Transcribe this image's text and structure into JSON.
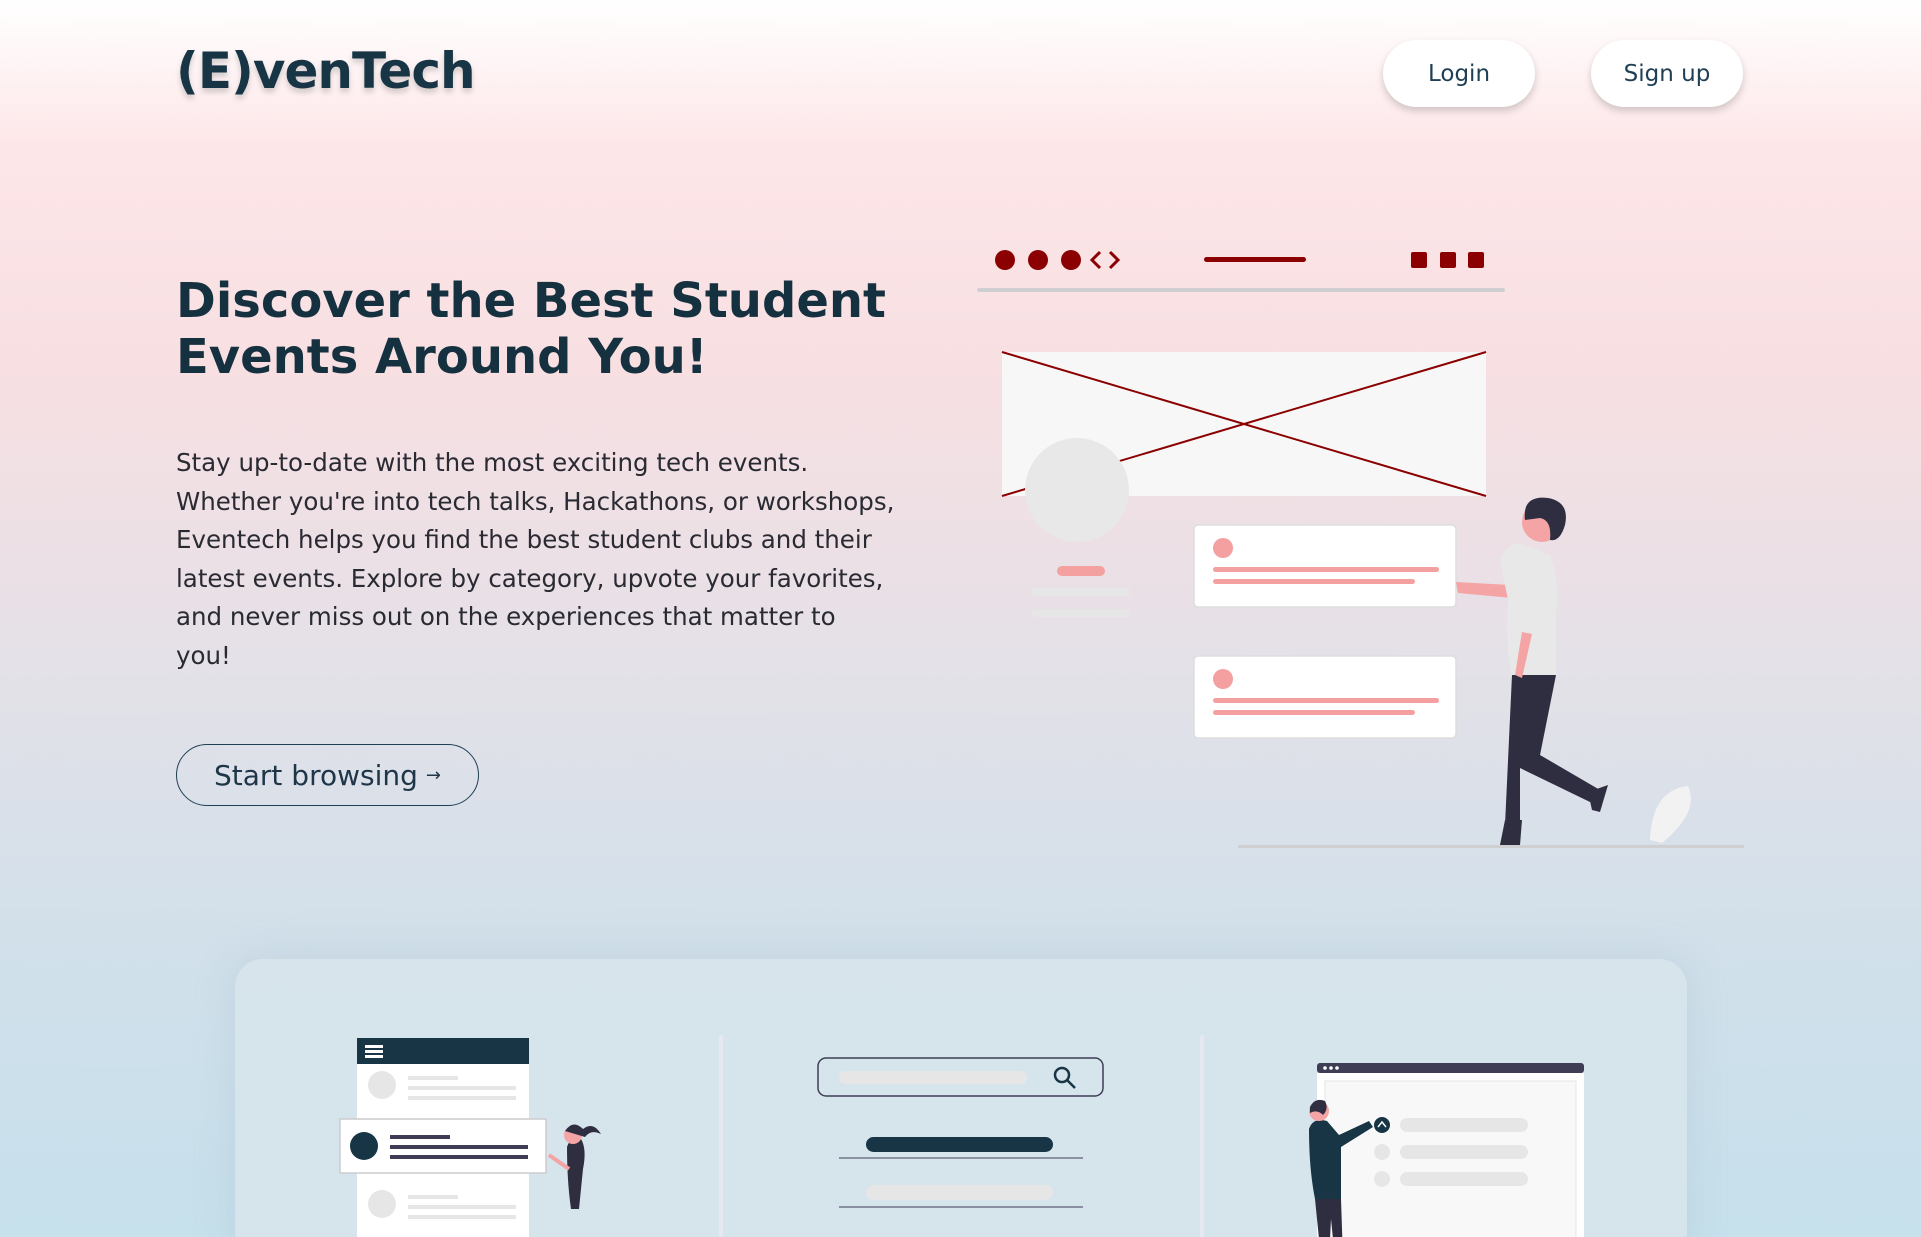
{
  "header": {
    "logo": "(E)venTech",
    "login_label": "Login",
    "signup_label": "Sign up"
  },
  "hero": {
    "title_line1": "Discover the Best Student",
    "title_line2": "Events Around You!",
    "description": "Stay up-to-date with the most exciting tech events. Whether you're into tech talks, Hackathons, or workshops, Eventech helps you find the best student clubs and their latest events. Explore by category, upvote your favorites, and never miss out on the experiences that matter to you!",
    "cta_label": "Start browsing",
    "cta_arrow": "→"
  },
  "colors": {
    "brand_dark": "#15303f",
    "accent_red": "#8b0000",
    "accent_pink": "#f5a0a0"
  },
  "icons": [
    "browser-dots-icon",
    "code-brackets-icon",
    "window-controls-icon",
    "search-icon",
    "upvote-icon"
  ]
}
